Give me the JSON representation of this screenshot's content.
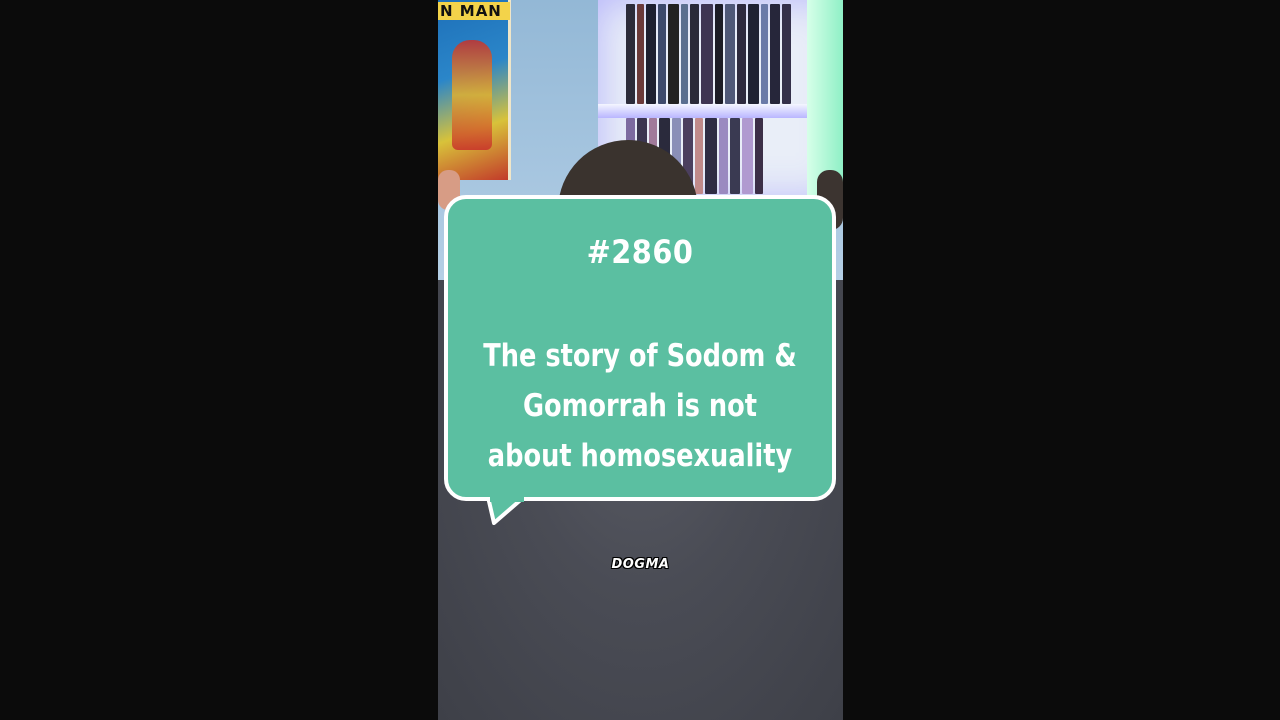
{
  "poster": {
    "title": "N MAN"
  },
  "bubble": {
    "number": "#2860",
    "line1": "The story of Sodom &",
    "line2": "Gomorrah is not",
    "line3": "about homosexuality"
  },
  "shirt": {
    "logo": "DOGMA"
  },
  "colors": {
    "bubble_fill": "#5bbfa1",
    "bubble_border": "#ffffff",
    "letterbox": "#0b0b0b"
  }
}
